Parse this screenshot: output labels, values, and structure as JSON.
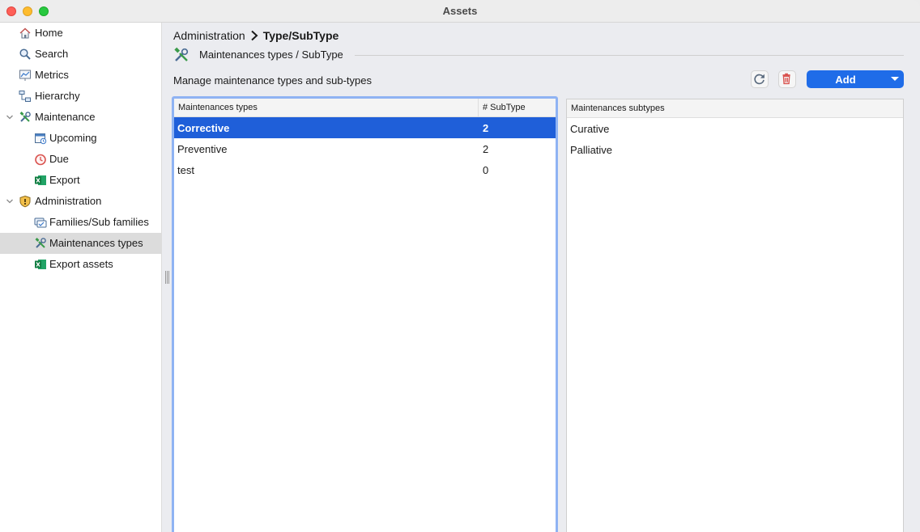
{
  "window": {
    "title": "Assets"
  },
  "sidebar": {
    "items": [
      {
        "label": "Home",
        "icon": "home-icon"
      },
      {
        "label": "Search",
        "icon": "search-icon"
      },
      {
        "label": "Metrics",
        "icon": "metrics-icon"
      },
      {
        "label": "Hierarchy",
        "icon": "hierarchy-icon"
      },
      {
        "label": "Maintenance",
        "icon": "maintenance-icon"
      },
      {
        "label": "Upcoming",
        "icon": "calendar-icon"
      },
      {
        "label": "Due",
        "icon": "clock-alert-icon"
      },
      {
        "label": "Export",
        "icon": "excel-icon"
      },
      {
        "label": "Administration",
        "icon": "shield-icon"
      },
      {
        "label": "Families/Sub families",
        "icon": "families-icon"
      },
      {
        "label": "Maintenances types",
        "icon": "tools-icon"
      },
      {
        "label": "Export assets",
        "icon": "excel-icon"
      }
    ],
    "selected": "Maintenances types"
  },
  "breadcrumb": {
    "parent": "Administration",
    "current": "Type/SubType"
  },
  "section": {
    "title": "Maintenances types / SubType"
  },
  "subtitle": "Manage maintenance types and sub-types",
  "toolbar": {
    "add_label": "Add"
  },
  "types_table": {
    "headers": [
      "Maintenances types",
      "# SubType"
    ],
    "rows": [
      {
        "name": "Corrective",
        "count": "2"
      },
      {
        "name": "Preventive",
        "count": "2"
      },
      {
        "name": "test",
        "count": "0"
      }
    ],
    "selected_row": "Corrective"
  },
  "subtypes_table": {
    "headers": [
      "Maintenances subtypes"
    ],
    "rows": [
      "Curative",
      "Palliative"
    ]
  },
  "colors": {
    "accent": "#1f5fd9",
    "button_primary": "#1f6ce8",
    "focus_ring": "#8fb3f3",
    "delete_red": "#d9534f"
  }
}
